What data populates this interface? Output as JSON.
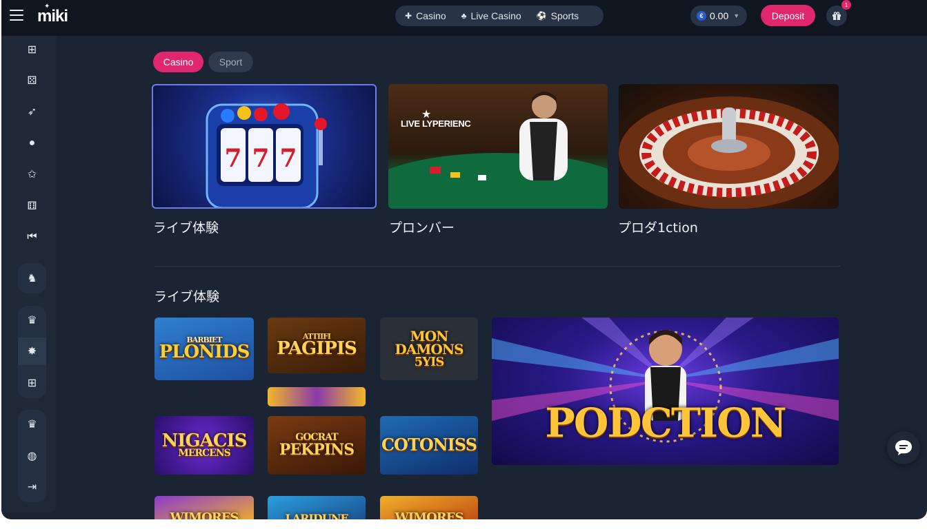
{
  "header": {
    "logo": "miki",
    "nav": [
      {
        "label": "Casino",
        "icon": "casino-chip-icon"
      },
      {
        "label": "Live Casino",
        "icon": "live-cards-icon"
      },
      {
        "label": "Sports",
        "icon": "soccer-ball-icon"
      }
    ],
    "balance": {
      "currency_symbol": "€",
      "amount": "0.00"
    },
    "deposit_label": "Deposit",
    "notification_count": "1"
  },
  "sidebar": {
    "items": [
      {
        "icon": "gift-box-icon"
      },
      {
        "icon": "slot-machine-icon"
      },
      {
        "icon": "rocket-icon"
      },
      {
        "icon": "poker-chip-icon"
      },
      {
        "icon": "star-badge-icon"
      },
      {
        "icon": "dice-icon"
      },
      {
        "icon": "skip-back-icon"
      },
      {
        "icon": "horse-icon"
      },
      {
        "icon": "crown-icon"
      },
      {
        "icon": "star-burst-icon"
      },
      {
        "icon": "present-icon"
      },
      {
        "icon": "crown-icon"
      },
      {
        "icon": "globe-icon"
      },
      {
        "icon": "exit-door-icon"
      }
    ]
  },
  "tabs": [
    {
      "label": "Casino",
      "active": true
    },
    {
      "label": "Sport",
      "active": false
    }
  ],
  "featured": [
    {
      "title": "ライブ体験",
      "image_label": ""
    },
    {
      "title": "プロンバー",
      "image_label": "LIVE LYPERIENC"
    },
    {
      "title": "プロダ1ction",
      "image_label": ""
    }
  ],
  "section": {
    "title": "ライブ体験",
    "tiles": [
      {
        "label": "PLONIDS",
        "sub": "BARBIET"
      },
      {
        "label": "PAGIPIS",
        "sub": "ATTIIFI"
      },
      {
        "label": "MON DAMONS",
        "sub": "5YIS"
      },
      {
        "label": "NIGACIS",
        "sub": "MERCENS"
      },
      {
        "label": "PEKPINS",
        "sub": "GOCRAT"
      },
      {
        "label": "COTONISS",
        "sub": ""
      },
      {
        "label": "WIMORES",
        "sub": ""
      },
      {
        "label": "LARIDUNE",
        "sub": ""
      },
      {
        "label": "WIMORES",
        "sub": ""
      }
    ],
    "banner": {
      "label": "PODCTION"
    }
  },
  "colors": {
    "accent": "#e0266c",
    "background": "#1b2432",
    "topbar": "#10161f",
    "sidebar": "#1f2836"
  }
}
